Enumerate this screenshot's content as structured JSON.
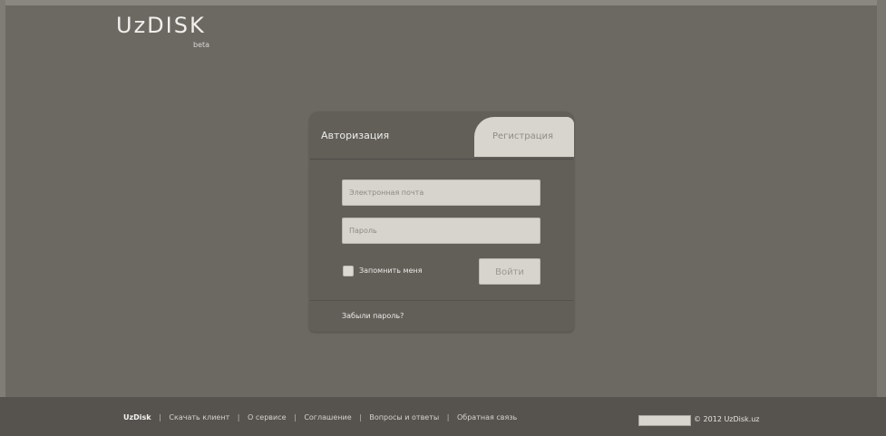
{
  "header": {
    "logo": "UzDISK",
    "logo_sub": "beta"
  },
  "auth": {
    "tab_login": "Авторизация",
    "tab_register": "Регистрация",
    "email_placeholder": "Электронная почта",
    "password_placeholder": "Пароль",
    "remember_label": "Запомнить меня",
    "login_button": "Войти",
    "forgot_link": "Забыли пароль?"
  },
  "footer": {
    "brand": "UzDisk",
    "links": [
      "Скачать клиент",
      "О сервисе",
      "Соглашение",
      "Вопросы и ответы",
      "Обратная связь"
    ],
    "copyright": "© 2012 UzDisk.uz"
  }
}
